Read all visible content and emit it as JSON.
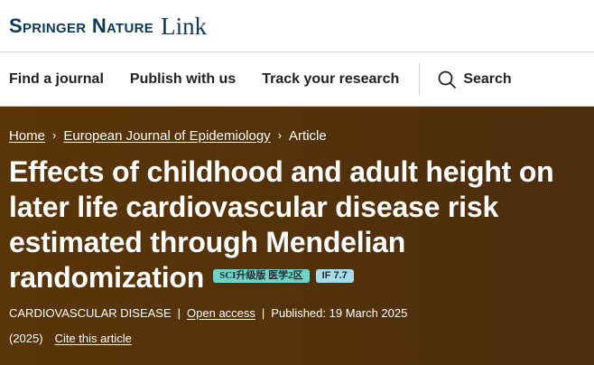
{
  "header": {
    "brand": "Springer Nature",
    "brand_link": "Link",
    "colors": {
      "brand": "#0b3a59",
      "hero_bg": "#55320a",
      "badge_sci": "#71d3c5",
      "badge_if": "#a7dde8"
    }
  },
  "nav": {
    "items": [
      {
        "label": "Find a journal"
      },
      {
        "label": "Publish with us"
      },
      {
        "label": "Track your research"
      }
    ],
    "search_label": "Search",
    "search_icon": "search-icon"
  },
  "breadcrumb": {
    "items": [
      "Home",
      "European Journal of Epidemiology",
      "Article"
    ],
    "separator": "›"
  },
  "article": {
    "title": "Effects of childhood and adult height on later life cardiovascular disease risk estimated through Mendelian randomization",
    "badges": {
      "sci": "SCI升级版 医学2区",
      "impact_factor": "IF 7.7"
    },
    "category": "CARDIOVASCULAR DISEASE",
    "access": "Open access",
    "published": "Published: 19 March 2025",
    "year": "(2025)",
    "cite_label": "Cite this article"
  }
}
